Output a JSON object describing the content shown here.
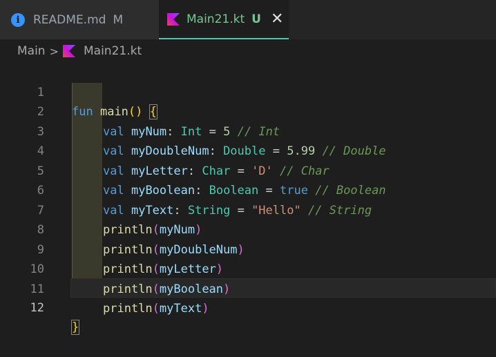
{
  "tabs": [
    {
      "label": "README.md",
      "status": "M",
      "icon": "info-icon"
    },
    {
      "label": "Main21.kt",
      "status": "U",
      "icon": "kotlin-icon",
      "close": "✕"
    }
  ],
  "breadcrumb": {
    "folder": "Main",
    "separator": ">",
    "file": "Main21.kt"
  },
  "line_numbers": [
    "1",
    "2",
    "3",
    "4",
    "5",
    "6",
    "7",
    "8",
    "9",
    "10",
    "11",
    "12"
  ],
  "code": {
    "l1": {
      "kw": "fun",
      "name": "main",
      "paren": "()",
      "brace": "{"
    },
    "l2": {
      "kw": "val",
      "name": "myNum",
      "colon": ":",
      "type": "Int",
      "eq": "=",
      "value": "5",
      "comment": "// Int"
    },
    "l3": {
      "kw": "val",
      "name": "myDoubleNum",
      "colon": ":",
      "type": "Double",
      "eq": "=",
      "value": "5.99",
      "comment": "// Double"
    },
    "l4": {
      "kw": "val",
      "name": "myLetter",
      "colon": ":",
      "type": "Char",
      "eq": "=",
      "value": "'D'",
      "comment": "// Char"
    },
    "l5": {
      "kw": "val",
      "name": "myBoolean",
      "colon": ":",
      "type": "Boolean",
      "eq": "=",
      "value": "true",
      "comment": "// Boolean"
    },
    "l6": {
      "kw": "val",
      "name": "myText",
      "colon": ":",
      "type": "String",
      "eq": "=",
      "value": "\"Hello\"",
      "comment": "// String"
    },
    "l7": {
      "fn": "println",
      "open": "(",
      "arg": "myNum",
      "close": ")"
    },
    "l8": {
      "fn": "println",
      "open": "(",
      "arg": "myDoubleNum",
      "close": ")"
    },
    "l9": {
      "fn": "println",
      "open": "(",
      "arg": "myLetter",
      "close": ")"
    },
    "l10": {
      "fn": "println",
      "open": "(",
      "arg": "myBoolean",
      "close": ")"
    },
    "l11": {
      "fn": "println",
      "open": "(",
      "arg": "myText",
      "close": ")"
    },
    "l12": {
      "brace": "}"
    }
  },
  "colors": {
    "accent": "#4ec9b0",
    "keyword": "#569cd6",
    "type": "#4ec9b0",
    "number": "#b5cea8",
    "string": "#ce9178",
    "comment": "#6a9955"
  }
}
